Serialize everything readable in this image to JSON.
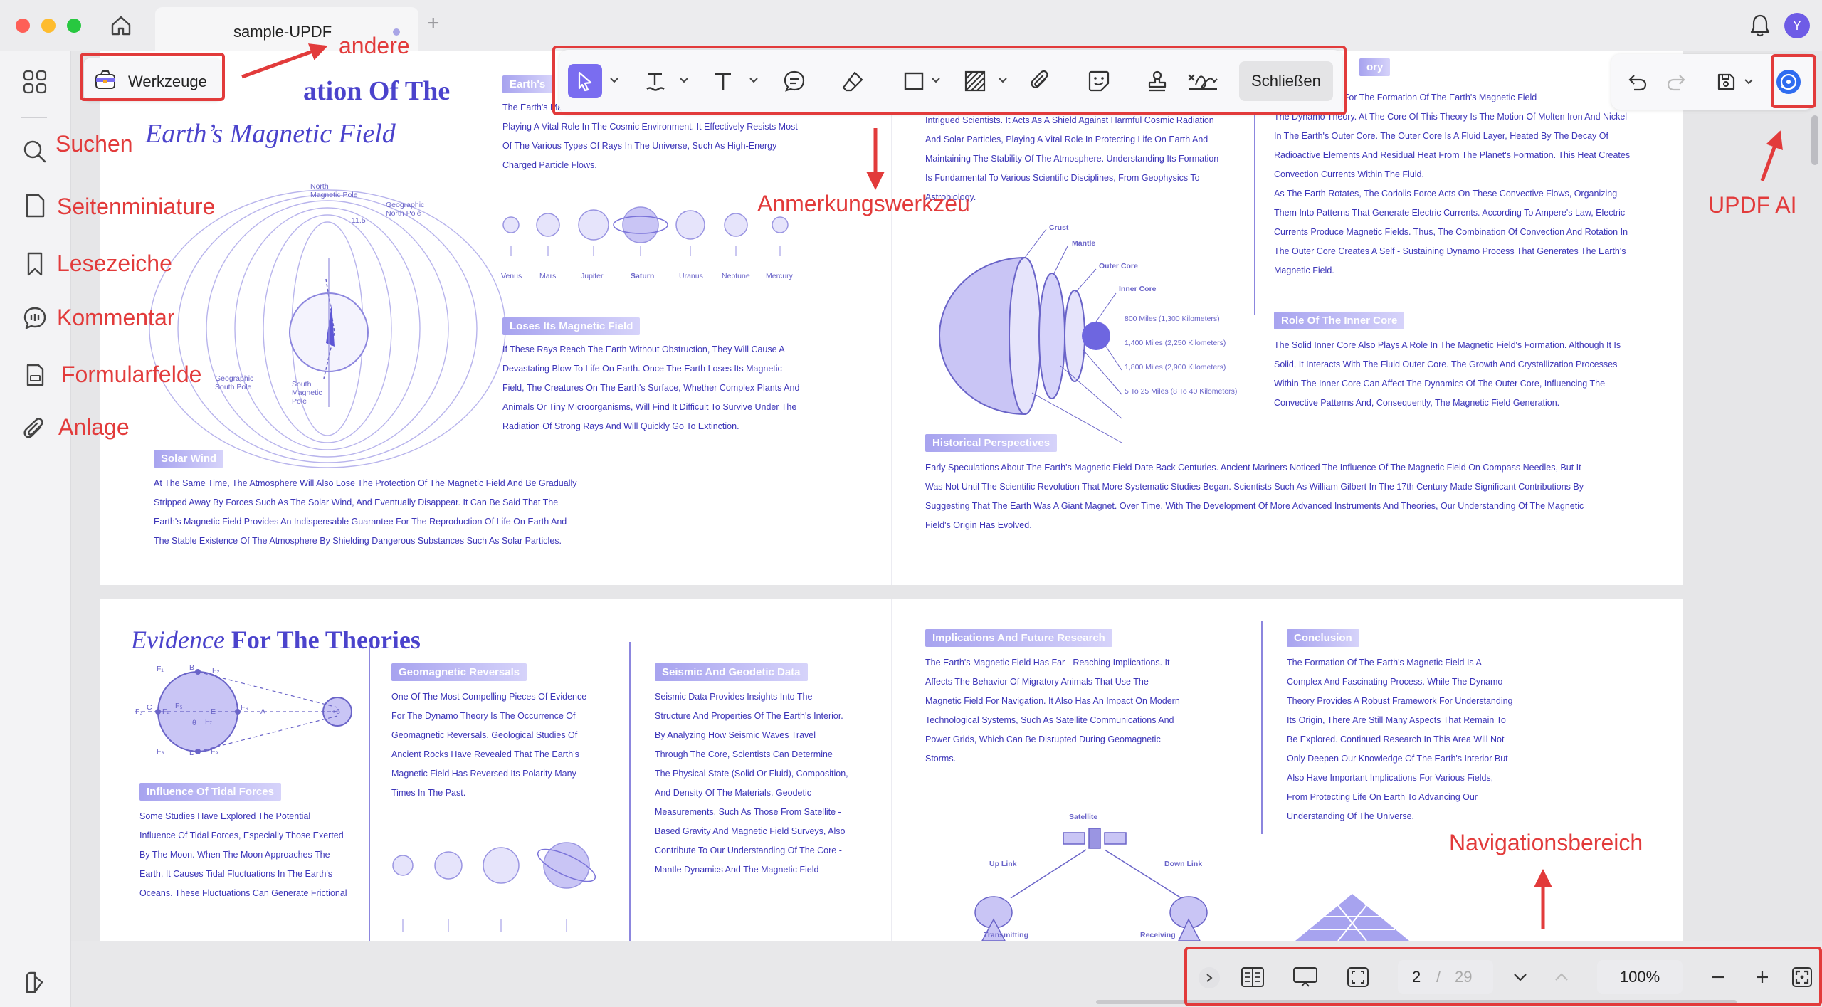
{
  "window": {
    "tab_title": "sample-UPDF",
    "tab_add": "+",
    "avatar_letter": "Y"
  },
  "toolbar": {
    "werkzeuge_label": "Werkzeuge",
    "close_label": "Schließen",
    "tools": [
      "select-tool",
      "text-highlight-tool",
      "text-tool",
      "comment-tool",
      "eraser-tool",
      "rectangle-tool",
      "area-tool",
      "attachment-tool",
      "sticker-tool",
      "stamp-tool",
      "signature-tool"
    ]
  },
  "navigation": {
    "current_page": "2",
    "separator": "/",
    "total_pages": "29",
    "zoom": "100%"
  },
  "annotations": {
    "andere": "andere",
    "suchen": "Suchen",
    "seitenminiature": "Seitenminiature",
    "lesezeiche": "Lesezeiche",
    "kommentar": "Kommentar",
    "formularfelde": "Formularfelde",
    "anlage": "Anlage",
    "anmerkungswerkzeu": "Anmerkungswerkzeu",
    "updf_ai": "UPDF AI",
    "navigationsbereich": "Navigationsbereich",
    "color": "#e23b3b"
  },
  "colors": {
    "accent": "#7a6df0",
    "doc_text": "#3c35b8",
    "heading": "#4b43cc"
  },
  "doc": {
    "p1": {
      "title_line1": "ation Of The",
      "title_line2": "Earth’s Magnetic Field",
      "earths_pill": "Earth's",
      "earths_text": "The Earth's Magnetic Field Is Like A Huge And Invisible Protective Shield,\nPlaying A Vital Role In The Cosmic Environment. It Effectively Resists Most\nOf The Various Types Of Rays In The Universe, Such As High-Energy\nCharged Particle Flows.",
      "planets": [
        "Venus",
        "Mars",
        "Jupiter",
        "Saturn",
        "Uranus",
        "Neptune",
        "Mercury"
      ],
      "loses_pill": "Loses Its Magnetic Field",
      "loses_text": "If These Rays Reach The Earth Without Obstruction, They Will Cause A\nDevastating Blow To Life On Earth. Once The Earth Loses Its Magnetic\nField, The Creatures On The Earth's Surface, Whether Complex Plants And\nAnimals Or Tiny Microorganisms, Will Find It Difficult To Survive Under The\nRadiation Of Strong Rays And Will Quickly Go To Extinction.",
      "solar_pill": "Solar Wind",
      "solar_text": "At The Same Time, The Atmosphere Will Also Lose The Protection Of The Magnetic Field And Be Gradually\nStripped Away By Forces Such As The Solar Wind, And Eventually Disappear. It Can Be Said That The\nEarth's Magnetic Field Provides An Indispensable Guarantee For The Reproduction Of Life On Earth And\nThe Stable Existence Of The Atmosphere By Shielding Dangerous Substances Such As Solar Particles.",
      "mag_labels": {
        "north_mag": "North\nMagnetic Pole",
        "geo_north": "Geographic\nNorth Pole",
        "geo_south": "Geographic\nSouth Pole",
        "south_mag": "South\nMagnetic\nPole",
        "angle": "11.5"
      }
    },
    "p2": {
      "intro_text": "Intrigued Scientists. It Acts As A Shield Against Harmful Cosmic Radiation\nAnd Solar Particles, Playing A Vital Role In Protecting Life On Earth And\nMaintaining The Stability Of The Atmosphere. Understanding Its Formation\nIs Fundamental To Various Scientific Disciplines, From Geophysics To\nAstrobiology.",
      "layers": [
        "Crust",
        "Mantle",
        "Outer Core",
        "Inner Core"
      ],
      "distances": [
        "800 Miles (1,300 Kilometers)",
        "1,400 Miles (2,250 Kilometers)",
        "1,800 Miles (2,900 Kilometers)",
        "5 To 25 Miles (8 To 40 Kilometers)"
      ],
      "theory_pill": "ory",
      "theory_text": "Accepted Theory For The Formation Of The Earth's Magnetic Field\nThe Dynamo Theory. At The Core Of This Theory Is The Motion Of Molten Iron And Nickel\nIn The Earth's Outer Core. The Outer Core Is A Fluid Layer, Heated By The Decay Of\nRadioactive Elements And Residual Heat From The Planet's Formation. This Heat Creates\nConvection Currents Within The Fluid.\nAs The Earth Rotates, The Coriolis Force Acts On These Convective Flows, Organizing\nThem Into Patterns That Generate Electric Currents. According To Ampere's Law, Electric\nCurrents Produce Magnetic Fields. Thus, The Combination Of Convection And Rotation In\nThe Outer Core Creates A Self - Sustaining Dynamo Process That Generates The Earth's\nMagnetic Field.",
      "inner_pill": "Role Of The Inner Core",
      "inner_text": "The Solid Inner Core Also Plays A Role In The Magnetic Field's Formation. Although It Is\nSolid, It Interacts With The Fluid Outer Core. The Growth And Crystallization Processes\nWithin The Inner Core Can Affect The Dynamics Of The Outer Core, Influencing The\nConvective Patterns And, Consequently, The Magnetic Field Generation.",
      "hist_pill": "Historical Perspectives",
      "hist_text": "Early Speculations About The Earth's Magnetic Field Date Back Centuries. Ancient Mariners Noticed The Influence Of The Magnetic Field On Compass Needles, But It\nWas Not Until The Scientific Revolution That More Systematic Studies Began. Scientists Such As William Gilbert In The 17th Century Made Significant Contributions By\nSuggesting That The Earth Was A Giant Magnet. Over Time, With The Development Of More Advanced Instruments And Theories, Our Understanding Of The Magnetic\nField's Origin Has Evolved."
    },
    "p3": {
      "title_italic": "Evidence",
      "title_rest": " For The Theories",
      "tidal_pill": "Influence Of Tidal Forces",
      "tidal_text": "Some Studies Have Explored The Potential\nInfluence Of Tidal Forces, Especially Those Exerted\nBy The Moon. When The Moon Approaches The\nEarth, It Causes Tidal Fluctuations In The Earth's\nOceans. These Fluctuations Can Generate Frictional",
      "geo_pill": "Geomagnetic Reversals",
      "geo_text": "One Of The Most Compelling Pieces Of Evidence\nFor The Dynamo Theory Is The Occurrence Of\nGeomagnetic Reversals. Geological Studies Of\nAncient Rocks Have Revealed That The Earth's\nMagnetic Field Has Reversed Its Polarity Many\nTimes In The Past.",
      "seismic_pill": "Seismic And Geodetic Data",
      "seismic_text": "Seismic Data Provides Insights Into The\nStructure And Properties Of The Earth's Interior.\nBy Analyzing How Seismic Waves Travel\nThrough The Core, Scientists Can Determine\nThe Physical State (Solid Or Fluid), Composition,\nAnd Density Of The Materials. Geodetic\nMeasurements, Such As Those From Satellite -\nBased Gravity And Magnetic Field Surveys, Also\nContribute To Our Understanding Of The Core -\nMantle Dynamics And The Magnetic Field",
      "force_labels": [
        "F₁",
        "B",
        "F₂",
        "F₃",
        "C",
        "F₄",
        "F₅",
        "E",
        "F₆",
        "A",
        "F₇",
        "F₈",
        "D",
        "F₉",
        "θ",
        "+6"
      ]
    },
    "p4": {
      "impl_pill": "Implications And Future Research",
      "impl_text": "The Earth's Magnetic Field Has Far - Reaching Implications. It\nAffects The Behavior Of Migratory Animals That Use The\nMagnetic Field For Navigation. It Also Has An Impact On Modern\nTechnological Systems, Such As Satellite Communications And\nPower Grids, Which Can Be Disrupted During Geomagnetic\nStorms.",
      "sat_labels": [
        "Satellite",
        "Up Link",
        "Down Link",
        "Transmitting",
        "Receiving"
      ],
      "concl_pill": "Conclusion",
      "concl_text": "The Formation Of The Earth's Magnetic Field Is A\nComplex And Fascinating Process. While The Dynamo\nTheory Provides A Robust Framework For Understanding\nIts Origin, There Are Still Many Aspects That Remain To\nBe Explored. Continued Research In This Area Will Not\nOnly Deepen Our Knowledge Of The Earth's Interior But\nAlso Have Important Implications For Various Fields,\nFrom Protecting Life On Earth To Advancing Our\nUnderstanding Of The Universe."
    }
  }
}
